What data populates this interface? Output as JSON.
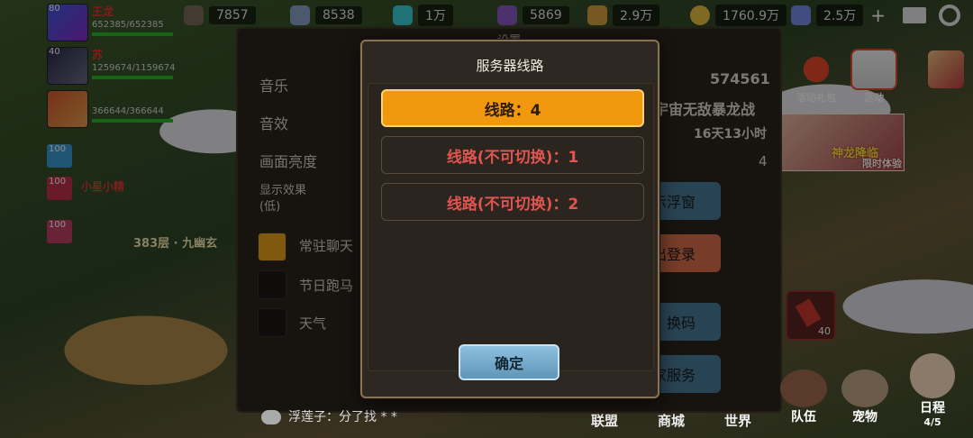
{
  "resources": [
    {
      "icon": "shard-icon",
      "value": "7857",
      "color": "#7a6a5a"
    },
    {
      "icon": "crystal-icon",
      "value": "8538",
      "color": "#8aa0c8"
    },
    {
      "icon": "gem-icon",
      "value": "1万",
      "color": "#3ad0d8"
    },
    {
      "icon": "rune-icon",
      "value": "5869",
      "color": "#8a5ac8"
    },
    {
      "icon": "treasure-icon",
      "value": "2.9万",
      "color": "#d8a040"
    },
    {
      "icon": "gold-coin-icon",
      "value": "1760.9万",
      "color": "#e8c040"
    },
    {
      "icon": "diamond-icon",
      "value": "2.5万",
      "color": "#7a8ae8"
    }
  ],
  "party": [
    {
      "level": "80",
      "name": "王龙",
      "hp": "652385/652385",
      "fill": 1.0
    },
    {
      "level": "40",
      "name": "苏",
      "hp": "1259674/1159674",
      "fill": 1.0
    },
    {
      "level": "",
      "name": "",
      "hp": "366644/366644",
      "fill": 1.0
    }
  ],
  "small_members": [
    {
      "level": "100",
      "name": "",
      "color": "#3a9ad0"
    },
    {
      "level": "100",
      "name": "小星小精",
      "color": "#c0304a"
    },
    {
      "level": "100",
      "name": "",
      "color": "#c04068"
    }
  ],
  "floor_label": "383层 · 九幽玄",
  "activities": [
    {
      "label": "活动礼包"
    },
    {
      "label": "活动"
    }
  ],
  "event_banner": {
    "line1": "神龙降临",
    "line2": "限时体验"
  },
  "item_count": "40",
  "settings": {
    "title": "设置",
    "rows": [
      "音乐",
      "音效",
      "画面亮度"
    ],
    "display_label": "显示效果",
    "display_sub": "(低)",
    "checkboxes": [
      {
        "label": "常驻聊天",
        "checked": true
      },
      {
        "label": "节日跑马",
        "checked": false
      },
      {
        "label": "天气",
        "checked": false
      }
    ],
    "id_value": "574561",
    "server_name": "宇宙无敌暴龙战",
    "duration": "16天13小时",
    "count": "4",
    "buttons": [
      "示浮窗",
      "出登录",
      "换码",
      "玩家服务"
    ]
  },
  "chat_line": "浮莲子：分了找 * *",
  "bottom_tabs": [
    "联盟",
    "商城",
    "世界"
  ],
  "bottom_icons": [
    {
      "label": "队伍"
    },
    {
      "label": "宠物"
    },
    {
      "label": "日程",
      "sub": "4/5"
    }
  ],
  "dialog": {
    "title": "服务器线路",
    "lines": [
      {
        "label": "线路：4",
        "active": true
      },
      {
        "label": "线路(不可切换)：1",
        "active": false
      },
      {
        "label": "线路(不可切换)：2",
        "active": false
      }
    ],
    "confirm": "确定"
  }
}
